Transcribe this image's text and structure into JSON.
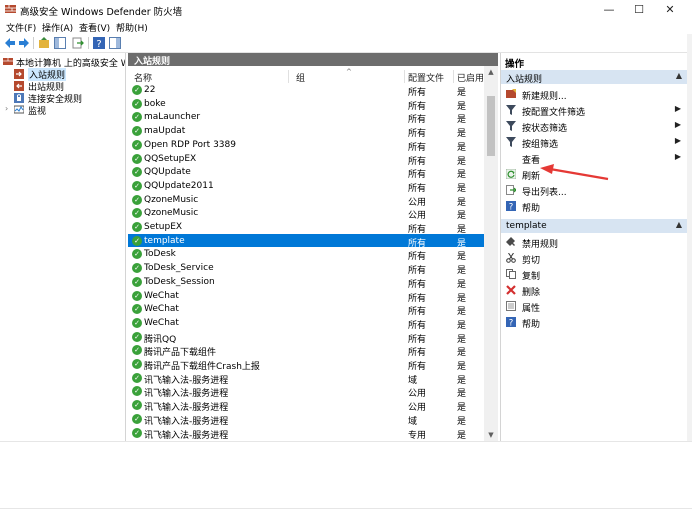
{
  "window": {
    "title": "高级安全 Windows Defender 防火墙",
    "minimize": "—",
    "maximize": "☐",
    "close": "✕"
  },
  "menu": [
    "文件(F)",
    "操作(A)",
    "查看(V)",
    "帮助(H)"
  ],
  "tree": {
    "root": "本地计算机 上的高级安全 Windo",
    "items": [
      "入站规则",
      "出站规则",
      "连接安全规则",
      "监视"
    ]
  },
  "center": {
    "header": "入站规则",
    "columns": {
      "name": "名称",
      "group": "组",
      "profile": "配置文件",
      "enabled": "已启用"
    },
    "rows": [
      {
        "name": "22",
        "profile": "所有",
        "enabled": "是"
      },
      {
        "name": "boke",
        "profile": "所有",
        "enabled": "是"
      },
      {
        "name": "maLauncher",
        "profile": "所有",
        "enabled": "是"
      },
      {
        "name": "maUpdat",
        "profile": "所有",
        "enabled": "是"
      },
      {
        "name": "Open RDP Port 3389",
        "profile": "所有",
        "enabled": "是"
      },
      {
        "name": "QQSetupEX",
        "profile": "所有",
        "enabled": "是"
      },
      {
        "name": "QQUpdate",
        "profile": "所有",
        "enabled": "是"
      },
      {
        "name": "QQUpdate2011",
        "profile": "所有",
        "enabled": "是"
      },
      {
        "name": "QzoneMusic",
        "profile": "公用",
        "enabled": "是"
      },
      {
        "name": "QzoneMusic",
        "profile": "公用",
        "enabled": "是"
      },
      {
        "name": "SetupEX",
        "profile": "所有",
        "enabled": "是"
      },
      {
        "name": "template",
        "profile": "所有",
        "enabled": "是",
        "selected": true
      },
      {
        "name": "ToDesk",
        "profile": "所有",
        "enabled": "是"
      },
      {
        "name": "ToDesk_Service",
        "profile": "所有",
        "enabled": "是"
      },
      {
        "name": "ToDesk_Session",
        "profile": "所有",
        "enabled": "是"
      },
      {
        "name": "WeChat",
        "profile": "所有",
        "enabled": "是"
      },
      {
        "name": "WeChat",
        "profile": "所有",
        "enabled": "是"
      },
      {
        "name": "WeChat",
        "profile": "所有",
        "enabled": "是"
      },
      {
        "name": "腾讯QQ",
        "profile": "所有",
        "enabled": "是"
      },
      {
        "name": "腾讯产品下载组件",
        "profile": "所有",
        "enabled": "是"
      },
      {
        "name": "腾讯产品下载组件Crash上报",
        "profile": "所有",
        "enabled": "是"
      },
      {
        "name": "讯飞输入法-服务进程",
        "profile": "域",
        "enabled": "是"
      },
      {
        "name": "讯飞输入法-服务进程",
        "profile": "公用",
        "enabled": "是"
      },
      {
        "name": "讯飞输入法-服务进程",
        "profile": "公用",
        "enabled": "是"
      },
      {
        "name": "讯飞输入法-服务进程",
        "profile": "域",
        "enabled": "是"
      },
      {
        "name": "讯飞输入法-服务进程",
        "profile": "专用",
        "enabled": "是"
      }
    ]
  },
  "actions": {
    "title": "操作",
    "section1": "入站规则",
    "items1": [
      "新建规则...",
      "按配置文件筛选",
      "按状态筛选",
      "按组筛选",
      "查看",
      "刷新",
      "导出列表...",
      "帮助"
    ],
    "section2": "template",
    "items2": [
      "禁用规则",
      "剪切",
      "复制",
      "删除",
      "属性",
      "帮助"
    ]
  },
  "colors": {
    "selection": "#0078d7",
    "section_bg": "#d7e4f2",
    "panel_header": "#6d6d6d",
    "annotation_arrow": "#e53935",
    "rule_enabled": "#3aa13a"
  }
}
